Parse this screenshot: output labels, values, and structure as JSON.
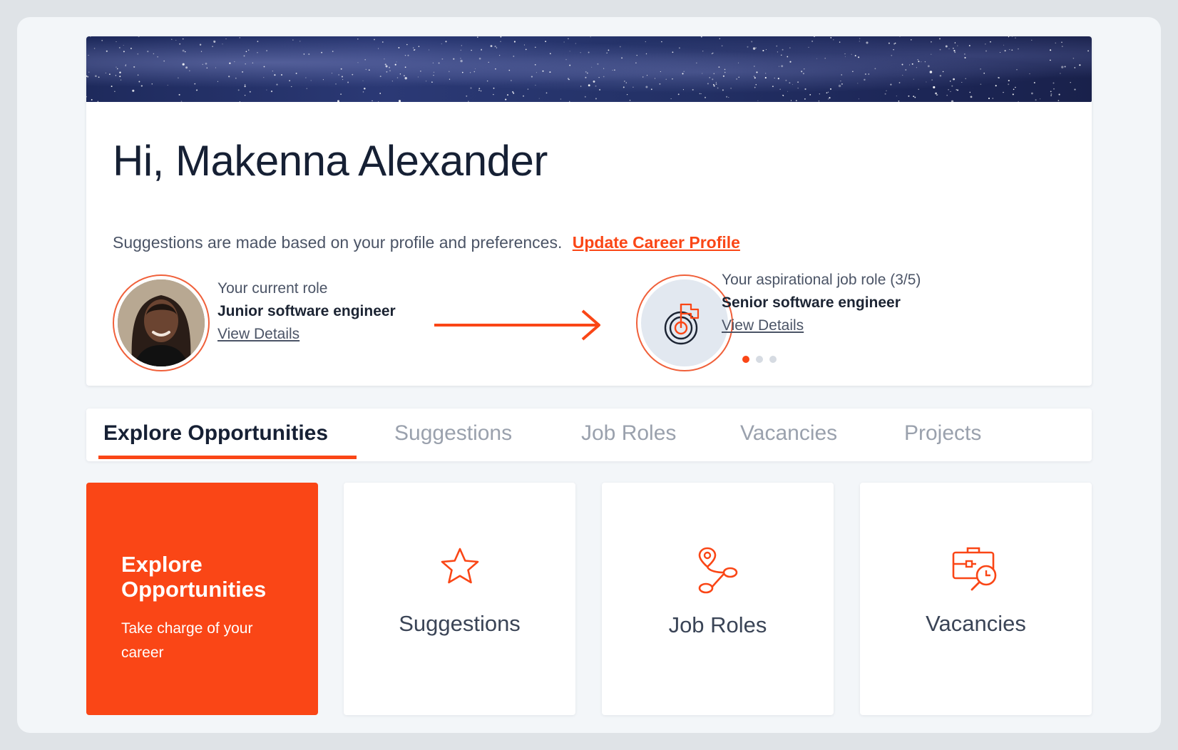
{
  "greeting": "Hi, Makenna Alexander",
  "subline": {
    "text": "Suggestions are made based on your profile and preferences.",
    "link": "Update Career Profile"
  },
  "current_role": {
    "label": "Your current role",
    "title": "Junior software engineer",
    "link": "View Details"
  },
  "aspirational_role": {
    "label": "Your aspirational job role (3/5)",
    "title": "Senior software engineer",
    "link": "View Details",
    "carousel_index": 1,
    "carousel_count": 3
  },
  "tabs": [
    {
      "label": "Explore Opportunities",
      "active": true
    },
    {
      "label": "Suggestions",
      "active": false
    },
    {
      "label": "Job Roles",
      "active": false
    },
    {
      "label": "Vacancies",
      "active": false
    },
    {
      "label": "Projects",
      "active": false
    }
  ],
  "tiles": {
    "primary": {
      "heading": "Explore Opportunities",
      "sub": "Take charge of your career"
    },
    "suggestions": {
      "label": "Suggestions",
      "icon": "star-icon"
    },
    "job_roles": {
      "label": "Job Roles",
      "icon": "career-path-icon"
    },
    "vacancies": {
      "label": "Vacancies",
      "icon": "briefcase-search-icon"
    }
  },
  "colors": {
    "accent": "#fa4616",
    "heading": "#162034",
    "muted": "#9aa1ad",
    "background": "#f3f6f9"
  }
}
